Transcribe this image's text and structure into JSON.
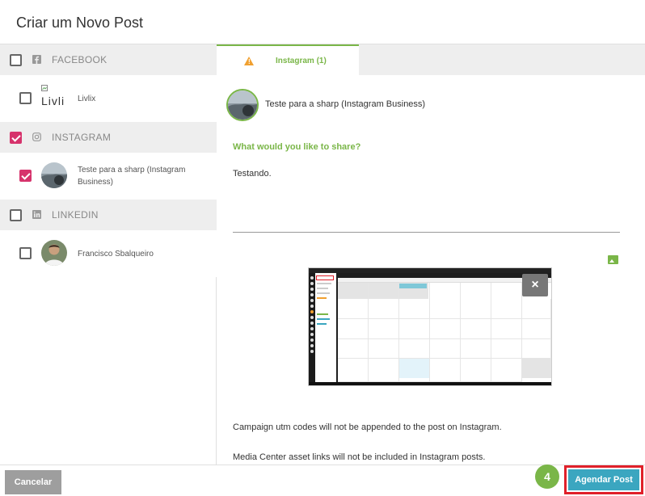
{
  "dialog": {
    "title": "Criar um Novo Post"
  },
  "accounts": {
    "facebook": {
      "group_label": "FACEBOOK",
      "group_icon": "facebook-icon",
      "items": [
        {
          "label": "Livlix",
          "logo_text": "Livli"
        }
      ]
    },
    "instagram": {
      "group_label": "INSTAGRAM",
      "group_icon": "instagram-icon",
      "items": [
        {
          "label": "Teste para a sharp (Instagram Business)",
          "label_line1": "Teste para a sharp (Instagram",
          "label_line2": "Business)"
        }
      ]
    },
    "linkedin": {
      "group_label": "LINKEDIN",
      "group_icon": "linkedin-icon",
      "items": [
        {
          "label": "Francisco Sbalqueiro"
        }
      ]
    }
  },
  "composer": {
    "tab_label": "Instagram (1)",
    "tab_warning_icon": "warning-icon",
    "profile_name": "Teste para a sharp (Instagram Business)",
    "share_prompt": "What would you like to share?",
    "message_text": "Testando.",
    "image_icon": "image-icon",
    "attachment_close": "×",
    "notes": [
      "Campaign utm codes will not be appended to the post on Instagram.",
      "Media Center asset links will not be included in Instagram posts."
    ]
  },
  "footer": {
    "cancel_label": "Cancelar",
    "step_number": "4",
    "schedule_label": "Agendar Post"
  },
  "colors": {
    "accent_green": "#7ab648",
    "checkbox_pink": "#d6336c",
    "schedule_button": "#3ba6c0",
    "highlight_red": "#e0202a",
    "cancel_button": "#9e9e9e"
  }
}
